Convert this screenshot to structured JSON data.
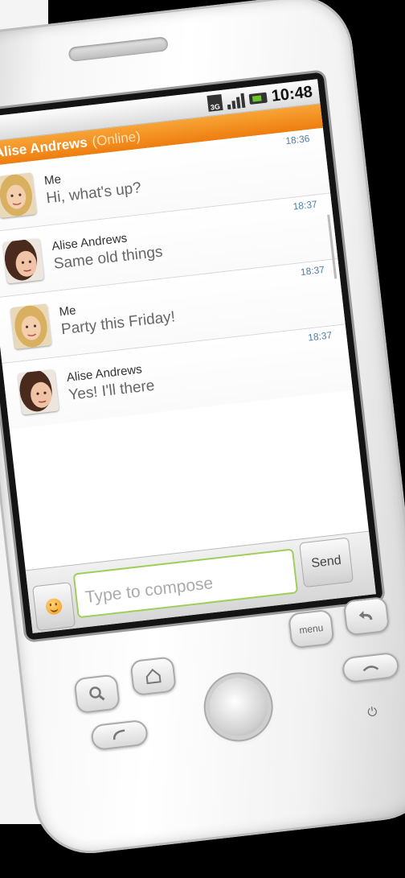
{
  "status_bar": {
    "network_label": "3G",
    "time": "10:48"
  },
  "conversation": {
    "contact_name": "Alise Andrews",
    "contact_status": "(Online)"
  },
  "messages": [
    {
      "sender": "Me",
      "text": "Hi, what's up?",
      "time": "18:36",
      "avatar": "me"
    },
    {
      "sender": "Alise Andrews",
      "text": "Same old things",
      "time": "18:37",
      "avatar": "alise"
    },
    {
      "sender": "Me",
      "text": "Party this Friday!",
      "time": "18:37",
      "avatar": "me"
    },
    {
      "sender": "Alise Andrews",
      "text": "Yes! I'll there",
      "time": "18:37",
      "avatar": "alise"
    }
  ],
  "compose": {
    "placeholder": "Type to compose",
    "send_label": "Send"
  },
  "hardware_buttons": {
    "menu_label": "menu"
  },
  "colors": {
    "accent": "#f08a1c",
    "input_border": "#9fcf5a",
    "timestamp": "#4d7ea8"
  },
  "icons": [
    "3g-icon",
    "signal-icon",
    "battery-icon",
    "chat-icon",
    "smiley-icon",
    "search-icon",
    "home-icon",
    "back-icon",
    "call-icon",
    "end-call-icon",
    "power-icon"
  ]
}
